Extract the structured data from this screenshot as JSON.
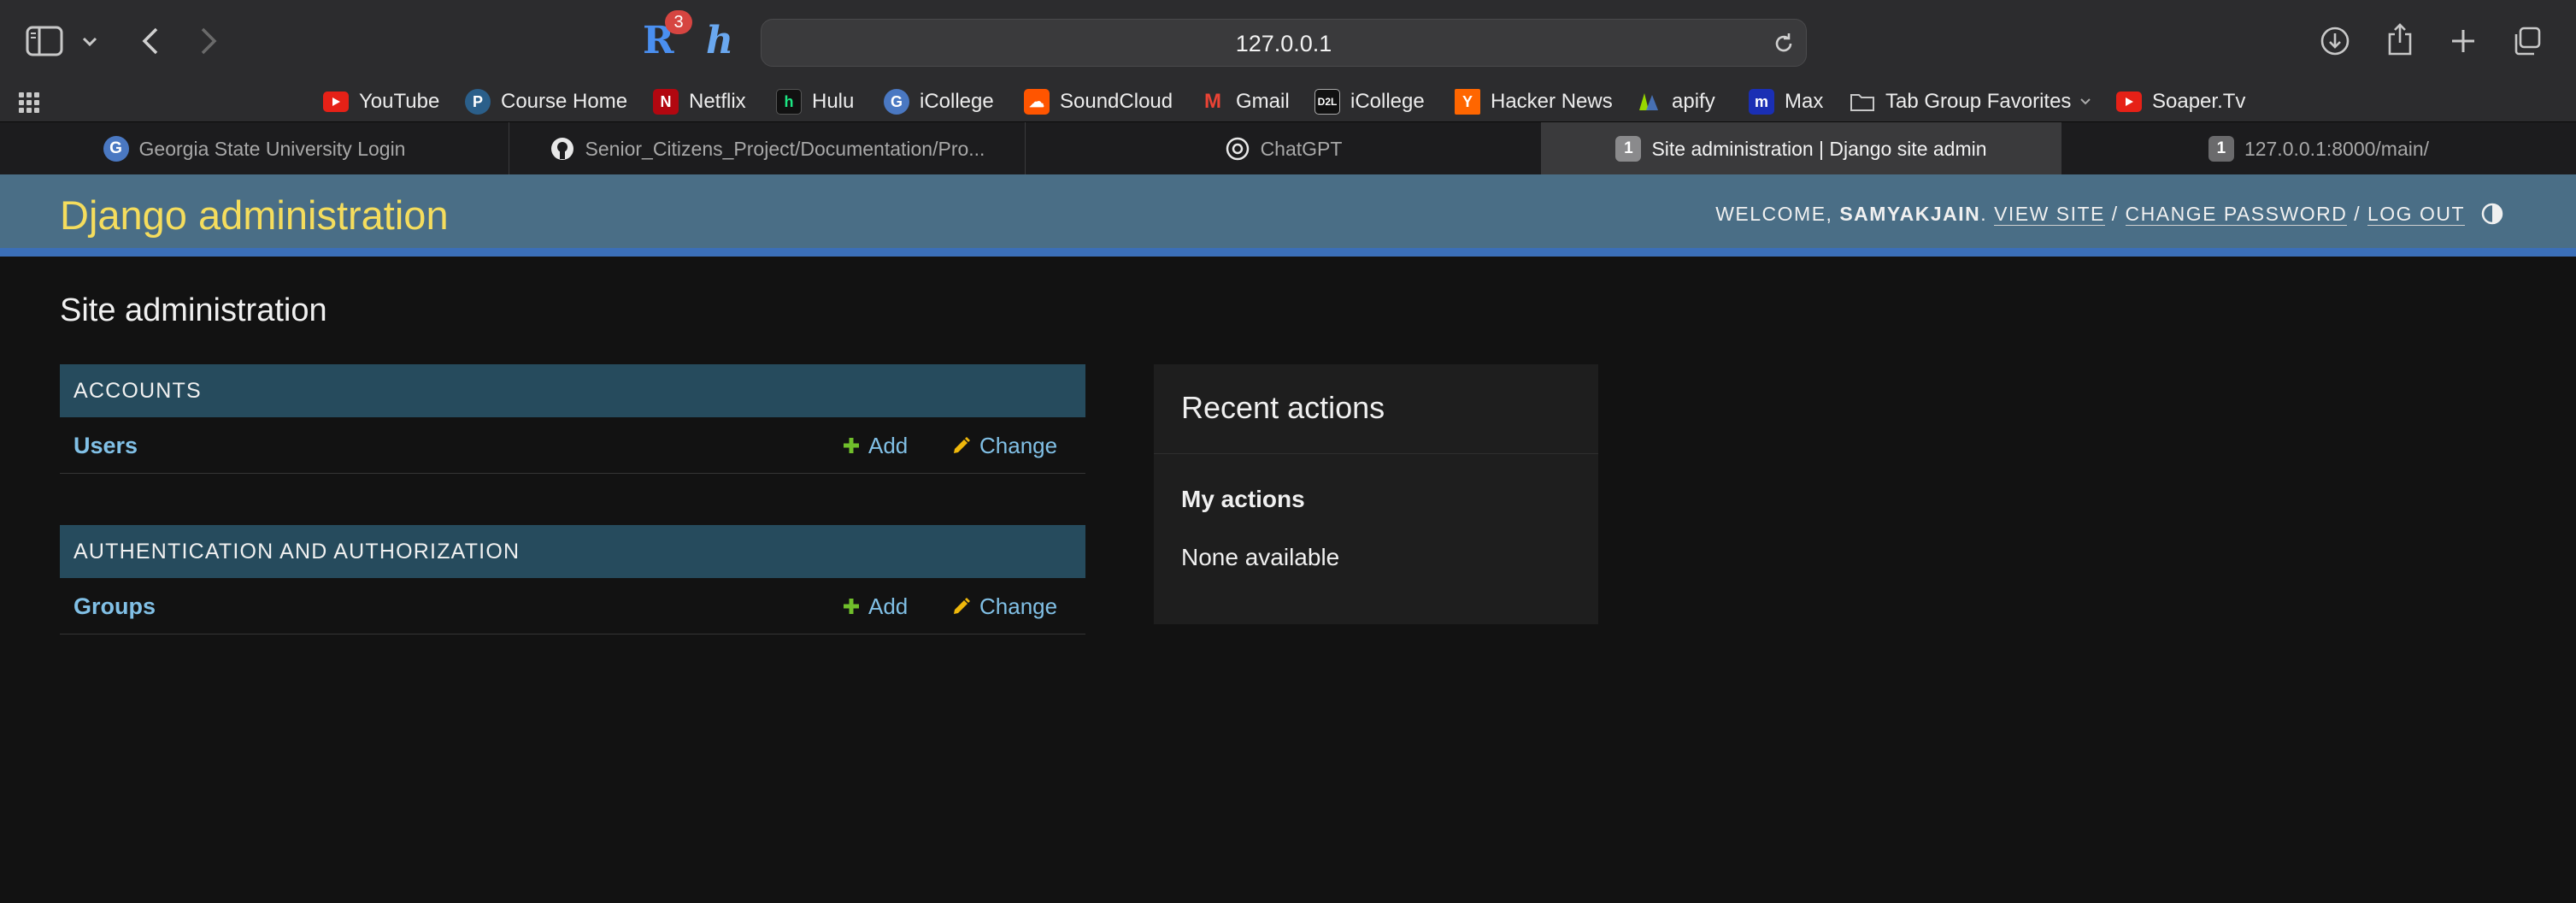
{
  "browser": {
    "url": "127.0.0.1",
    "extension_badge": "3",
    "extension_r_label": "R",
    "extension_h_label": "h"
  },
  "bookmarks": [
    {
      "label": "YouTube",
      "icon": "youtube-icon",
      "color": "#e62117"
    },
    {
      "label": "Course Home",
      "icon": "pearson-icon",
      "color": "#2b5f8a"
    },
    {
      "label": "Netflix",
      "icon": "netflix-icon",
      "color": "#b20710"
    },
    {
      "label": "Hulu",
      "icon": "hulu-icon",
      "color": "#1ce783"
    },
    {
      "label": "iCollege",
      "icon": "gsu-icon",
      "color": "#4a78c2"
    },
    {
      "label": "SoundCloud",
      "icon": "soundcloud-icon",
      "color": "#ff5500"
    },
    {
      "label": "Gmail",
      "icon": "gmail-icon",
      "color": "#ea4335"
    },
    {
      "label": "iCollege",
      "icon": "d2l-icon",
      "color": "#111111"
    },
    {
      "label": "Hacker News",
      "icon": "hacker-news-icon",
      "color": "#ff6600"
    },
    {
      "label": "apify",
      "icon": "apify-icon",
      "color": "#97d700"
    },
    {
      "label": "Max",
      "icon": "max-icon",
      "color": "#1a2fb4"
    },
    {
      "label": "Tab Group Favorites",
      "icon": "folder-icon",
      "color": "#c8c8c8"
    },
    {
      "label": "Soaper.Tv",
      "icon": "soaper-icon",
      "color": "#e62117"
    }
  ],
  "tabs": [
    {
      "label": "Georgia State University Login",
      "icon": "gsu-icon",
      "active": false
    },
    {
      "label": "Senior_Citizens_Project/Documentation/Pro...",
      "icon": "github-icon",
      "active": false
    },
    {
      "label": "ChatGPT",
      "icon": "chatgpt-icon",
      "active": false
    },
    {
      "label": "Site administration | Django site admin",
      "icon": "django-tab-icon",
      "active": true,
      "badge": "1"
    },
    {
      "label": "127.0.0.1:8000/main/",
      "icon": "local-tab-icon",
      "active": false,
      "badge": "1"
    }
  ],
  "admin": {
    "branding": "Django administration",
    "welcome": "WELCOME,",
    "username": "SAMYAKJAIN",
    "view_site": "VIEW SITE",
    "change_password": "CHANGE PASSWORD",
    "log_out": "LOG OUT",
    "separator": "/",
    "page_title": "Site administration",
    "modules": [
      {
        "caption": "ACCOUNTS",
        "rows": [
          {
            "model": "Users",
            "add": "Add",
            "change": "Change"
          }
        ]
      },
      {
        "caption": "AUTHENTICATION AND AUTHORIZATION",
        "rows": [
          {
            "model": "Groups",
            "add": "Add",
            "change": "Change"
          }
        ]
      }
    ],
    "recent_actions": {
      "title": "Recent actions",
      "subtitle": "My actions",
      "empty": "None available"
    }
  },
  "colors": {
    "header_bg": "#4a6e86",
    "branding": "#f5dd5d",
    "module_caption_bg": "#264b5d",
    "link": "#81c0e6",
    "add_icon": "#70bf2b",
    "change_icon": "#efb80b"
  }
}
